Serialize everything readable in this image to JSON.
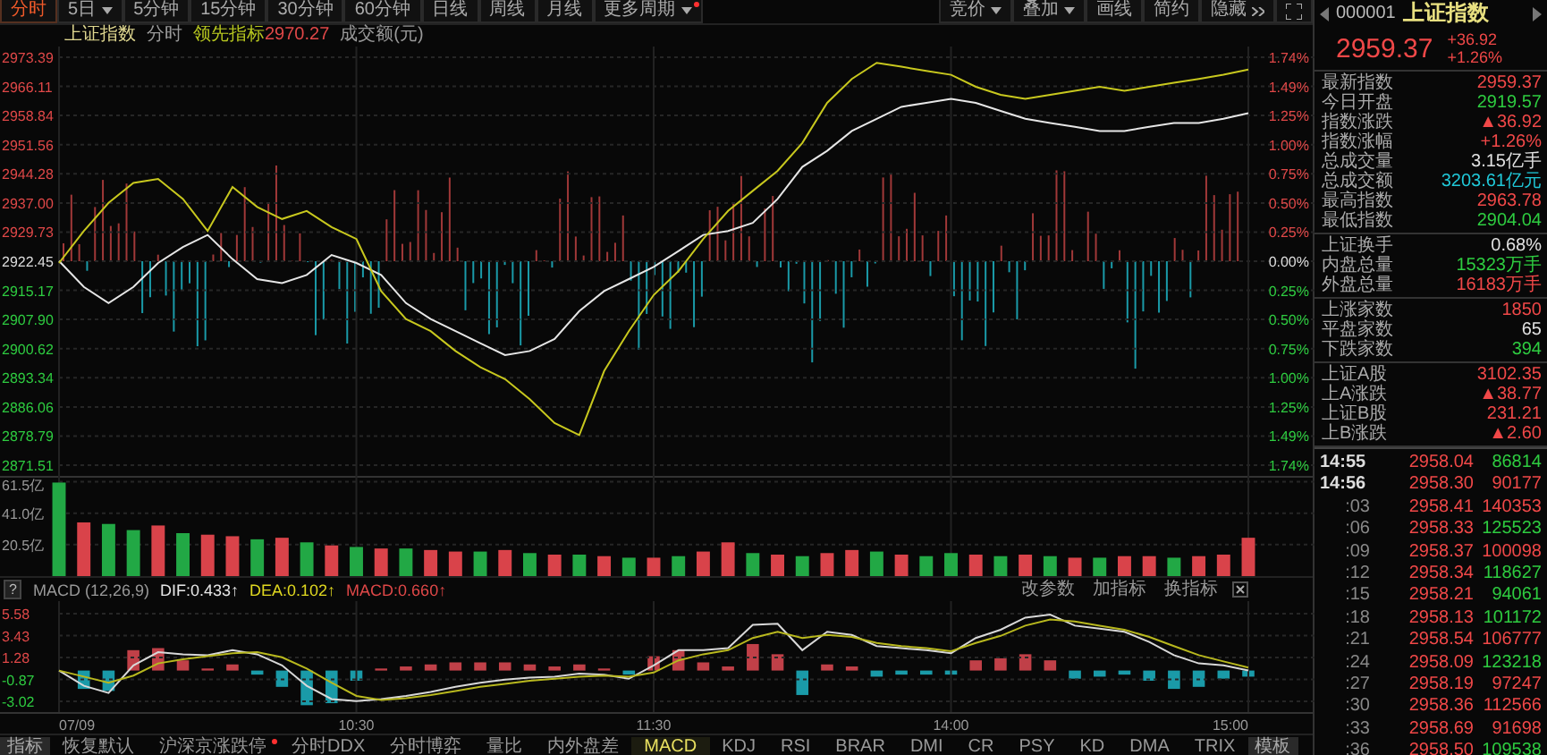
{
  "toolbar": {
    "periods": [
      {
        "label": "分时",
        "selected": true,
        "dropdown": false,
        "dot": false
      },
      {
        "label": "5日",
        "selected": false,
        "dropdown": true,
        "dot": false
      },
      {
        "label": "5分钟",
        "selected": false,
        "dropdown": false,
        "dot": false
      },
      {
        "label": "15分钟",
        "selected": false,
        "dropdown": false,
        "dot": false
      },
      {
        "label": "30分钟",
        "selected": false,
        "dropdown": false,
        "dot": false
      },
      {
        "label": "60分钟",
        "selected": false,
        "dropdown": false,
        "dot": false
      },
      {
        "label": "日线",
        "selected": false,
        "dropdown": false,
        "dot": false
      },
      {
        "label": "周线",
        "selected": false,
        "dropdown": false,
        "dot": false
      },
      {
        "label": "月线",
        "selected": false,
        "dropdown": false,
        "dot": false
      },
      {
        "label": "更多周期",
        "selected": false,
        "dropdown": true,
        "dot": true
      }
    ],
    "tools": [
      {
        "label": "竞价",
        "kind": "menu"
      },
      {
        "label": "叠加",
        "kind": "menu"
      },
      {
        "label": "画线",
        "kind": "button"
      },
      {
        "label": "简约",
        "kind": "button"
      },
      {
        "label": "隐藏",
        "kind": "collapse"
      }
    ]
  },
  "legend": {
    "mode": "分时",
    "lead_value": "2970.27",
    "volume_label": "成交额(元)"
  },
  "price_chart": {
    "percent_ticks": [
      "1.74%",
      "1.49%",
      "1.25%",
      "1.00%",
      "0.75%",
      "0.50%",
      "0.25%",
      "0.00%",
      "0.25%",
      "0.50%",
      "0.75%",
      "1.00%",
      "1.25%",
      "1.49%",
      "1.74%"
    ],
    "chart_data": {
      "type": "line",
      "grid": true,
      "ylim": [
        2871.51,
        2973.39
      ],
      "yticks": [
        {
          "value": 2973.39,
          "label": "2973.39"
        },
        {
          "value": 2966.11,
          "label": "2966.11"
        },
        {
          "value": 2958.84,
          "label": "2958.84"
        },
        {
          "value": 2951.56,
          "label": "2951.56"
        },
        {
          "value": 2944.28,
          "label": "2944.28"
        },
        {
          "value": 2937.0,
          "label": "2937.00"
        },
        {
          "value": 2929.73,
          "label": "2929.73"
        },
        {
          "value": 2922.45,
          "label": "2922.45"
        },
        {
          "value": 2915.17,
          "label": "2915.17"
        },
        {
          "value": 2907.9,
          "label": "2907.90"
        },
        {
          "value": 2900.62,
          "label": "2900.62"
        },
        {
          "value": 2893.34,
          "label": "2893.34"
        },
        {
          "value": 2886.06,
          "label": "2886.06"
        },
        {
          "value": 2878.79,
          "label": "2878.79"
        },
        {
          "value": 2871.51,
          "label": "2871.51"
        }
      ],
      "series": [
        {
          "name": "上证指数",
          "color": "#e6e6e6",
          "values": [
            2922.5,
            2916,
            2912,
            2916,
            2922,
            2926,
            2929,
            2923,
            2918,
            2917,
            2919,
            2924,
            2922,
            2919,
            2912,
            2908,
            2905,
            2902,
            2899,
            2900,
            2903,
            2910,
            2915,
            2918,
            2921,
            2925,
            2929,
            2930,
            2932,
            2938,
            2946,
            2950,
            2955,
            2958,
            2961,
            2962,
            2963,
            2962,
            2960,
            2958,
            2957,
            2956,
            2955,
            2955,
            2956,
            2957,
            2957,
            2958,
            2959.4
          ]
        },
        {
          "name": "领先指标",
          "color": "#c8c81e",
          "values": [
            2922,
            2930,
            2937,
            2942,
            2943,
            2938,
            2930,
            2941,
            2936,
            2933,
            2935,
            2931,
            2928,
            2915,
            2908,
            2905,
            2900,
            2896,
            2893,
            2888,
            2882,
            2879,
            2895,
            2905,
            2914,
            2920,
            2928,
            2935,
            2940,
            2945,
            2952,
            2962,
            2968,
            2972,
            2971,
            2970,
            2969,
            2966,
            2964,
            2963,
            2964,
            2965,
            2966,
            2965,
            2966,
            2967,
            2968,
            2969,
            2970.3
          ]
        }
      ]
    }
  },
  "volume_chart": {
    "chart_data": {
      "type": "bar",
      "stacked": true,
      "grid": true,
      "ylim": [
        0,
        63
      ],
      "yticks": [
        {
          "value": 61.5,
          "label": "61.5亿"
        },
        {
          "value": 41.0,
          "label": "41.0亿"
        },
        {
          "value": 20.5,
          "label": "20.5亿"
        }
      ],
      "series": [
        {
          "color": "#d9434a",
          "values": [
            null,
            35,
            null,
            null,
            33,
            null,
            27,
            26,
            null,
            25,
            null,
            20,
            null,
            18,
            null,
            17,
            16,
            null,
            17,
            null,
            14,
            null,
            13,
            null,
            12,
            null,
            16,
            22,
            null,
            14,
            null,
            15,
            17,
            null,
            14,
            null,
            null,
            14,
            null,
            14,
            null,
            12,
            null,
            13,
            13,
            null,
            13,
            14,
            25
          ]
        },
        {
          "color": "#22a845",
          "values": [
            61,
            null,
            34,
            30,
            null,
            28,
            null,
            null,
            24,
            null,
            22,
            null,
            19,
            null,
            18,
            null,
            null,
            16,
            null,
            15,
            null,
            14,
            null,
            12,
            null,
            13,
            null,
            null,
            15,
            null,
            13,
            null,
            null,
            16,
            null,
            13,
            15,
            null,
            13,
            null,
            13,
            null,
            12,
            null,
            null,
            12,
            null,
            null,
            null
          ]
        }
      ]
    }
  },
  "macd_panel": {
    "help": "?",
    "title": "MACD (12,26,9)",
    "readings": [
      {
        "text": "DIF:0.433↑",
        "color": "#e6e6e6"
      },
      {
        "text": "DEA:0.102↑",
        "color": "#e0d820"
      },
      {
        "text": "MACD:0.660↑",
        "color": "#e04848"
      }
    ],
    "actions": [
      "改参数",
      "加指标",
      "换指标"
    ],
    "chart_data": {
      "type": "line",
      "grid": true,
      "ylim": [
        -3.02,
        5.58
      ],
      "yticks": [
        {
          "value": 5.58,
          "label": "5.58"
        },
        {
          "value": 3.43,
          "label": "3.43"
        },
        {
          "value": 1.28,
          "label": "1.28"
        },
        {
          "value": -0.87,
          "label": "-0.87"
        },
        {
          "value": -3.02,
          "label": "-3.02"
        }
      ],
      "series": [
        {
          "color": "#d8d8d8",
          "values": [
            0,
            -1.5,
            -2.2,
            0.5,
            1.8,
            1.6,
            1.5,
            2.0,
            1.6,
            0.5,
            -1.5,
            -2.8,
            -3.0,
            -2.8,
            -2.5,
            -2.1,
            -1.6,
            -1.2,
            -0.9,
            -0.7,
            -0.6,
            -0.3,
            -0.4,
            -0.8,
            0.5,
            2.0,
            2.0,
            2.2,
            4.5,
            4.6,
            2.0,
            3.8,
            3.5,
            2.4,
            2.2,
            2.0,
            1.7,
            3.2,
            4.0,
            5.2,
            5.5,
            4.4,
            4.1,
            3.8,
            2.8,
            1.5,
            0.7,
            0.5,
            0.0
          ]
        },
        {
          "color": "#b8b81e",
          "values": [
            0,
            -0.6,
            -1.2,
            -0.5,
            0.7,
            1.1,
            1.4,
            1.7,
            1.8,
            1.3,
            0.2,
            -1.2,
            -2.5,
            -2.9,
            -2.7,
            -2.4,
            -2.0,
            -1.6,
            -1.3,
            -1.0,
            -0.8,
            -0.6,
            -0.5,
            -0.6,
            -0.2,
            1.0,
            1.6,
            2.0,
            3.2,
            3.8,
            3.2,
            3.5,
            3.3,
            2.7,
            2.4,
            2.2,
            1.9,
            2.7,
            3.4,
            4.4,
            5.0,
            4.8,
            4.4,
            4.0,
            3.3,
            2.4,
            1.5,
            0.9,
            0.3
          ]
        }
      ]
    }
  },
  "time_axis": [
    "07/09",
    "10:30",
    "11:30",
    "14:00",
    "15:00"
  ],
  "indicator_tabs": [
    {
      "label": "指标",
      "kind": "title",
      "selected": false,
      "dot": false
    },
    {
      "label": "恢复默认",
      "kind": "tab",
      "selected": false,
      "dot": false
    },
    {
      "label": "沪深京涨跌停",
      "kind": "tab",
      "selected": false,
      "dot": true
    },
    {
      "label": "分时DDX",
      "kind": "tab",
      "selected": false,
      "dot": false
    },
    {
      "label": "分时博弈",
      "kind": "tab",
      "selected": false,
      "dot": false
    },
    {
      "label": "量比",
      "kind": "tab",
      "selected": false,
      "dot": false
    },
    {
      "label": "内外盘差",
      "kind": "tab",
      "selected": false,
      "dot": false
    },
    {
      "label": "MACD",
      "kind": "tab",
      "selected": true,
      "dot": false
    },
    {
      "label": "KDJ",
      "kind": "tab",
      "selected": false,
      "dot": false
    },
    {
      "label": "RSI",
      "kind": "tab",
      "selected": false,
      "dot": false
    },
    {
      "label": "BRAR",
      "kind": "tab",
      "selected": false,
      "dot": false
    },
    {
      "label": "DMI",
      "kind": "tab",
      "selected": false,
      "dot": false
    },
    {
      "label": "CR",
      "kind": "tab",
      "selected": false,
      "dot": false
    },
    {
      "label": "PSY",
      "kind": "tab",
      "selected": false,
      "dot": false
    },
    {
      "label": "KD",
      "kind": "tab",
      "selected": false,
      "dot": false
    },
    {
      "label": "DMA",
      "kind": "tab",
      "selected": false,
      "dot": false
    },
    {
      "label": "TRIX",
      "kind": "tab",
      "selected": false,
      "dot": false
    },
    {
      "label": "模板",
      "kind": "title",
      "selected": false,
      "dot": false
    }
  ],
  "quote": {
    "code": "000001",
    "name": "上证指数",
    "price": "2959.37",
    "change": "+36.92",
    "change_pct": "+1.26%"
  },
  "stats": [
    [
      {
        "label": "最新指数",
        "value": "2959.37",
        "color": "#f04848"
      },
      {
        "label": "今日开盘",
        "value": "2919.57",
        "color": "#2ecc40"
      },
      {
        "label": "指数涨跌",
        "value": "▲36.92",
        "color": "#f04848"
      },
      {
        "label": "指数涨幅",
        "value": "+1.26%",
        "color": "#f04848"
      },
      {
        "label": "总成交量",
        "value": "3.15亿手",
        "color": "#e0e0e0"
      },
      {
        "label": "总成交额",
        "value": "3203.61亿元",
        "color": "#20c8d8"
      },
      {
        "label": "最高指数",
        "value": "2963.78",
        "color": "#f04848"
      },
      {
        "label": "最低指数",
        "value": "2904.04",
        "color": "#2ecc40"
      }
    ],
    [
      {
        "label": "上证换手",
        "value": "0.68%",
        "color": "#e0e0e0"
      },
      {
        "label": "内盘总量",
        "value": "15323万手",
        "color": "#2ecc40"
      },
      {
        "label": "外盘总量",
        "value": "16183万手",
        "color": "#f04848"
      }
    ],
    [
      {
        "label": "上涨家数",
        "value": "1850",
        "color": "#f04848"
      },
      {
        "label": "平盘家数",
        "value": "65",
        "color": "#e0e0e0"
      },
      {
        "label": "下跌家数",
        "value": "394",
        "color": "#2ecc40"
      }
    ],
    [
      {
        "label": "上证A股",
        "value": "3102.35",
        "color": "#f04848"
      },
      {
        "label": "上A涨跌",
        "value": "▲38.77",
        "color": "#f04848"
      },
      {
        "label": "上证B股",
        "value": "231.21",
        "color": "#f04848"
      },
      {
        "label": "上B涨跌",
        "value": "▲2.60",
        "color": "#f04848"
      }
    ]
  ],
  "ticks": [
    {
      "time": "14:55",
      "kind": "minute",
      "price": "2958.04",
      "volume": "86814",
      "color": "#2ecc40"
    },
    {
      "time": "14:56",
      "kind": "minute",
      "price": "2958.30",
      "volume": "90177",
      "color": "#f04848"
    },
    {
      "time": ":03",
      "kind": "second",
      "price": "2958.41",
      "volume": "140353",
      "color": "#f04848"
    },
    {
      "time": ":06",
      "kind": "second",
      "price": "2958.33",
      "volume": "125523",
      "color": "#2ecc40"
    },
    {
      "time": ":09",
      "kind": "second",
      "price": "2958.37",
      "volume": "100098",
      "color": "#f04848"
    },
    {
      "time": ":12",
      "kind": "second",
      "price": "2958.34",
      "volume": "118627",
      "color": "#2ecc40"
    },
    {
      "time": ":15",
      "kind": "second",
      "price": "2958.21",
      "volume": "94061",
      "color": "#2ecc40"
    },
    {
      "time": ":18",
      "kind": "second",
      "price": "2958.13",
      "volume": "101172",
      "color": "#2ecc40"
    },
    {
      "time": ":21",
      "kind": "second",
      "price": "2958.54",
      "volume": "106777",
      "color": "#f04848"
    },
    {
      "time": ":24",
      "kind": "second",
      "price": "2958.09",
      "volume": "123218",
      "color": "#2ecc40"
    },
    {
      "time": ":27",
      "kind": "second",
      "price": "2958.19",
      "volume": "97247",
      "color": "#f04848"
    },
    {
      "time": ":30",
      "kind": "second",
      "price": "2958.36",
      "volume": "112566",
      "color": "#f04848"
    },
    {
      "time": ":33",
      "kind": "second",
      "price": "2958.69",
      "volume": "91698",
      "color": "#f04848"
    },
    {
      "time": ":36",
      "kind": "second",
      "price": "2958.50",
      "volume": "109538",
      "color": "#2ecc40"
    }
  ]
}
